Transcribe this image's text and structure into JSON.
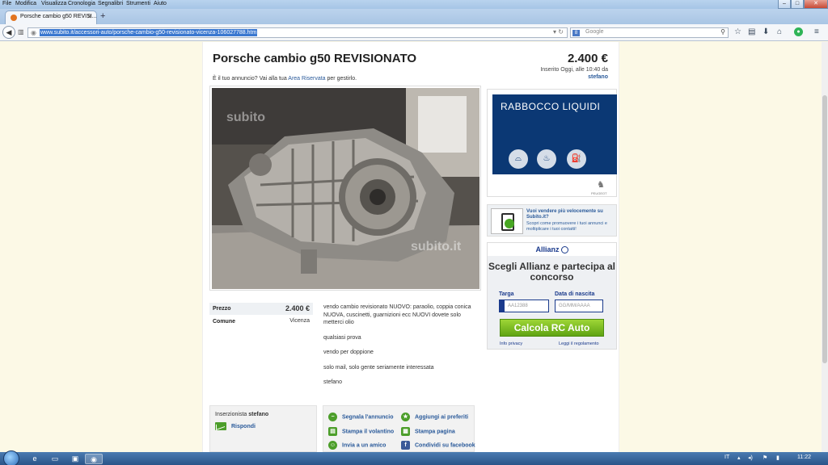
{
  "browser": {
    "menu": [
      "File",
      "Modifica",
      "Visualizza",
      "Cronologia",
      "Segnalibri",
      "Strumenti",
      "Aiuto"
    ],
    "window_controls": {
      "minimize": "–",
      "maximize": "□",
      "close": "✕"
    },
    "tab_title": "Porsche cambio g50 REVISI...",
    "new_tab": "+",
    "url": "www.subito.it/accessori-auto/porsche-cambio-g50-revisionato-vicenza-106027788.htm",
    "search_placeholder": "Google"
  },
  "ad": {
    "title": "Porsche cambio g50 REVISIONATO",
    "price": "2.400 €",
    "date": "Inserito Oggi, alle 10:40 da",
    "user": "stefano",
    "owner_prefix": "È il tuo annuncio? Vai alla tua ",
    "owner_link": "Area Riservata",
    "owner_suffix": " per gestirlo.",
    "watermark": "subito",
    "watermark2": "subito.it",
    "details": [
      {
        "key": "Prezzo",
        "value": "2.400 €"
      },
      {
        "key": "Comune",
        "value": "Vicenza"
      }
    ],
    "description": [
      "vendo cambio revisionato NUOVO: paraolio, coppia conica NUOVA, cuscinetti, guarnizioni ecc NUOVI dovete solo metterci olio",
      "qualsiasi prova",
      "vendo per doppione",
      "solo mail, solo gente seriamente interessata",
      "stefano"
    ],
    "advertiser_label": "Inserzionista",
    "advertiser_name": "stefano",
    "reply": "Rispondi",
    "actions": {
      "report": "Segnala l'annuncio",
      "favorite": "Aggiungi ai preferiti",
      "flyer": "Stampa il volantino",
      "print": "Stampa pagina",
      "invite": "Invia a un amico",
      "facebook": "Condividi su facebook"
    }
  },
  "sidebar": {
    "peugeot_title": "RABBOCCO LIQUIDI",
    "peugeot_brand": "PEUGEOT",
    "sell_headline": "Vuoi vendere più velocemente su Subito.it?",
    "sell_text": "Scopri come promuovere i tuoi annunci e moltiplicare i tuoi contatti!",
    "allianz_brand": "Allianz",
    "allianz_heading": "Scegli Allianz e partecipa al concorso",
    "targa_label": "Targa",
    "targa_placeholder": "AA12388",
    "birth_label": "Data di nascita",
    "birth_placeholder": "GG/MM/AAAA",
    "cta": "Calcola RC Auto",
    "privacy": "Info privacy",
    "rules": "Leggi il regolamento"
  },
  "taskbar": {
    "language": "IT",
    "time": "11:22"
  }
}
